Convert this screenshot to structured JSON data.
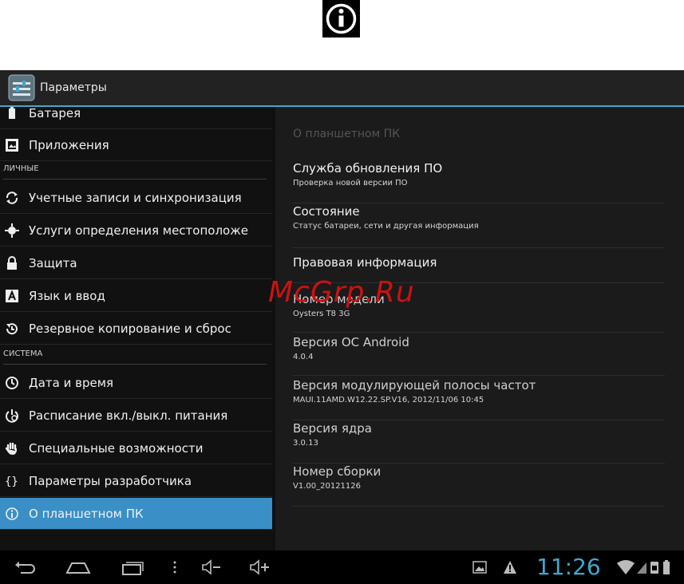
{
  "window": {
    "title": "Параметры"
  },
  "sidebar": {
    "items": [
      {
        "label": "Батарея"
      },
      {
        "label": "Приложения"
      },
      {
        "label": "Учетные записи и синхронизация"
      },
      {
        "label": "Услуги определения местоположе"
      },
      {
        "label": "Защита"
      },
      {
        "label": "Язык и ввод"
      },
      {
        "label": "Резервное копирование и сброс"
      },
      {
        "label": "Дата и время"
      },
      {
        "label": "Расписание вкл./выкл. питания"
      },
      {
        "label": "Специальные возможности"
      },
      {
        "label": "Параметры разработчика"
      },
      {
        "label": "О планшетном ПК"
      }
    ],
    "sections": {
      "personal": "ЛИЧНЫЕ",
      "system": "СИСТЕМА"
    }
  },
  "detail": {
    "header": "О планшетном ПК",
    "items": [
      {
        "title": "Служба обновления ПО",
        "subtitle": "Проверка новой версии ПО"
      },
      {
        "title": "Состояние",
        "subtitle": "Статус батареи, сети и другая информация"
      },
      {
        "title": "Правовая информация"
      },
      {
        "title": "Номер модели",
        "subtitle": "Oysters T8 3G"
      },
      {
        "title": "Версия ОС Android",
        "subtitle": "4.0.4"
      },
      {
        "title": "Версия модулирующей полосы частот",
        "subtitle": "MAUI.11AMD.W12.22.SP.V16, 2012/11/06 10:45"
      },
      {
        "title": "Версия ядра",
        "subtitle": "3.0.13"
      },
      {
        "title": "Номер сборки",
        "subtitle": "V1.00_20121126"
      }
    ]
  },
  "statusbar": {
    "clock": "11:26"
  },
  "watermark": "McGrp.Ru",
  "colors": {
    "accent": "#3fa8cf",
    "selected": "#3a8fc6",
    "watermark": "#cc1111"
  }
}
